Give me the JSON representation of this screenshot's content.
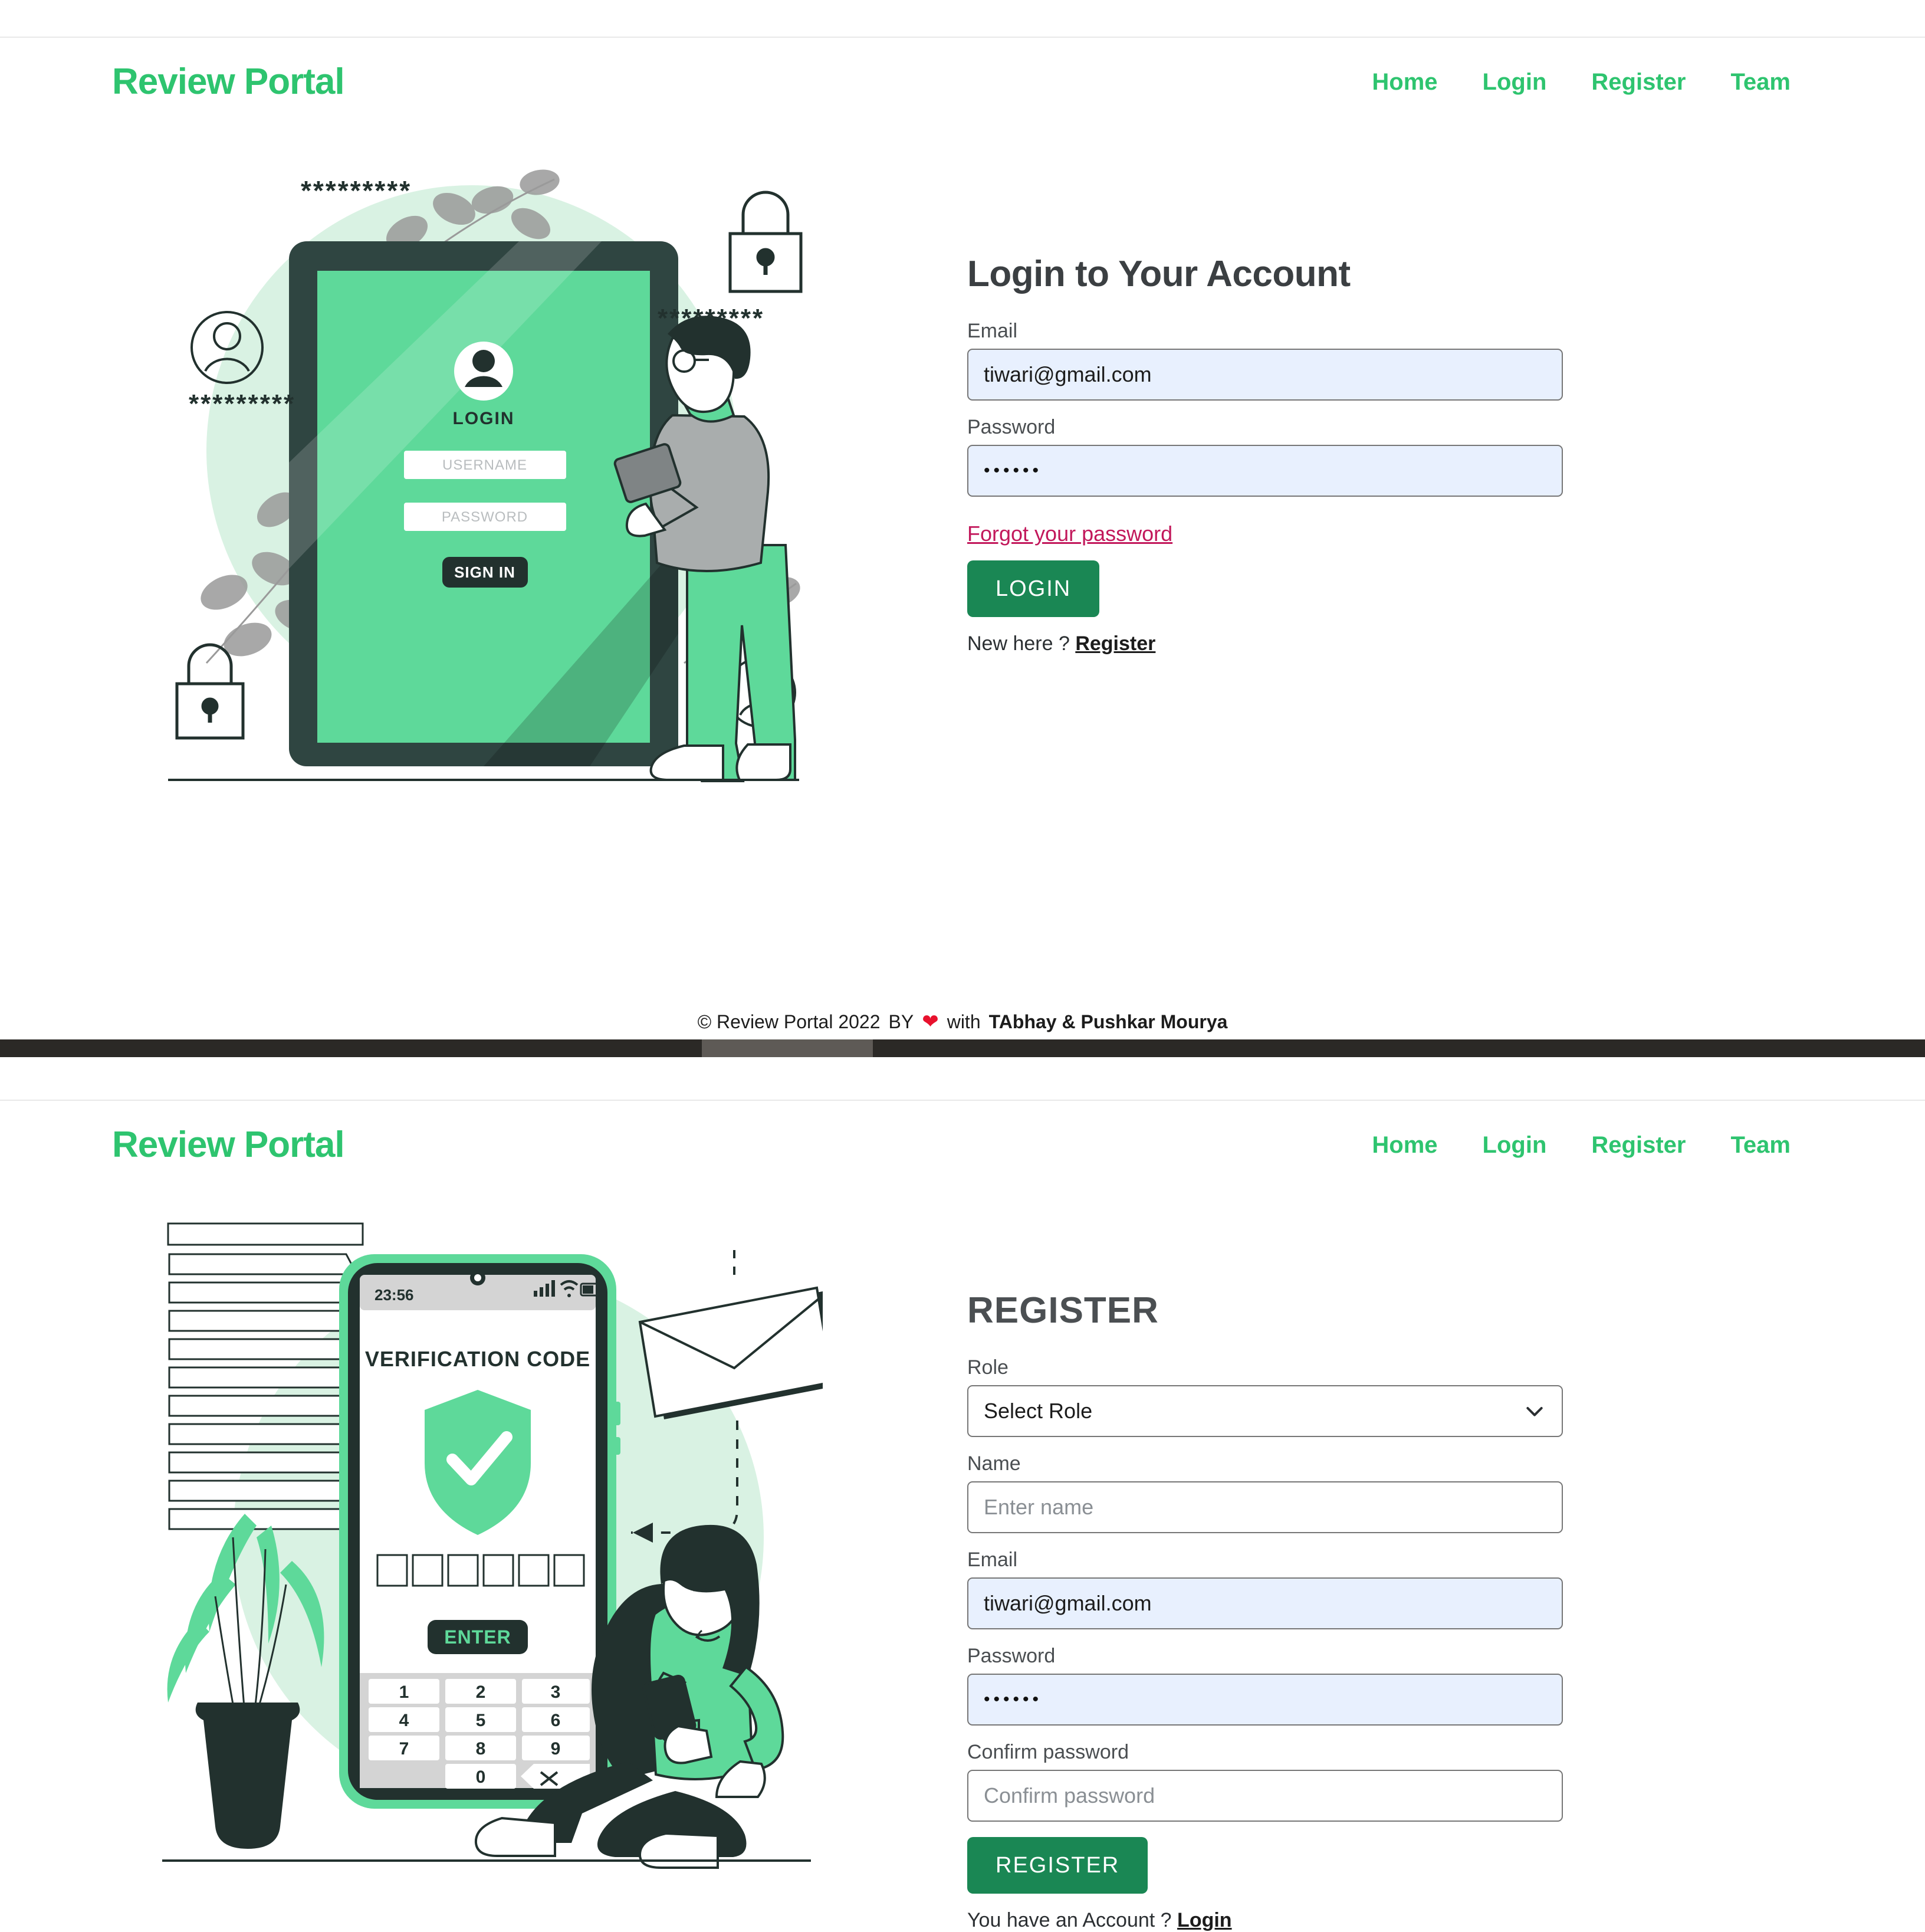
{
  "brand": "Review Portal",
  "nav": [
    {
      "label": "Home"
    },
    {
      "label": "Login"
    },
    {
      "label": "Register"
    },
    {
      "label": "Team"
    }
  ],
  "colors": {
    "brand_green": "#2ec46f",
    "button_green": "#1a8754",
    "link_red": "#c2185b",
    "autofill_blue": "#e8f0fe",
    "illustration_mint": "#d9f2e3",
    "illustration_green": "#5ed99a",
    "illustration_dark": "#243b37",
    "scrollbar_track": "#2b2926",
    "scrollbar_thumb": "#5e5a56"
  },
  "login_page": {
    "title": "Login to Your Account",
    "email": {
      "label": "Email",
      "value": "tiwari@gmail.com"
    },
    "password": {
      "label": "Password",
      "value": "••••••"
    },
    "forgot_link": "Forgot your password",
    "submit_label": "LOGIN",
    "footer_note_prefix": "New here ?",
    "footer_note_link": "Register",
    "illustration": {
      "screen_title": "LOGIN",
      "username_placeholder": "USERNAME",
      "password_placeholder": "PASSWORD",
      "signin_label": "SIGN IN",
      "masked_1": "*********",
      "masked_2": "*********",
      "masked_3": "*********"
    }
  },
  "footer": {
    "copyright": "© Review Portal 2022",
    "by": "BY",
    "heart": "❤",
    "with": "with",
    "authors": "TAbhay & Pushkar Mourya"
  },
  "register_page": {
    "title": "REGISTER",
    "role": {
      "label": "Role",
      "value": "Select Role"
    },
    "name": {
      "label": "Name",
      "placeholder": "Enter name"
    },
    "email": {
      "label": "Email",
      "value": "tiwari@gmail.com"
    },
    "password": {
      "label": "Password",
      "value": "••••••"
    },
    "confirm": {
      "label": "Confirm password",
      "placeholder": "Confirm password"
    },
    "submit_label": "REGISTER",
    "footer_note_prefix": "You have an Account ?",
    "footer_note_link": "Login",
    "illustration": {
      "clock": "23:56",
      "screen_title": "VERIFICATION CODE",
      "enter_label": "ENTER",
      "keys": [
        "1",
        "2",
        "3",
        "4",
        "5",
        "6",
        "7",
        "8",
        "9",
        "0"
      ]
    }
  }
}
